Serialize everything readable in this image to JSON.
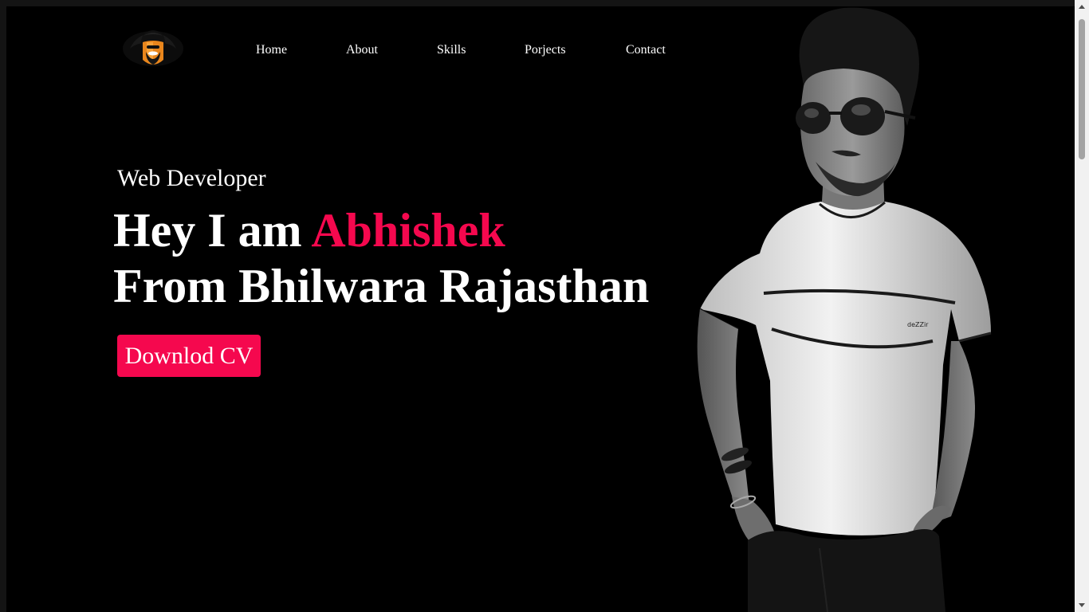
{
  "logo": {
    "icon": "bearded-man-avatar-icon"
  },
  "nav": {
    "items": [
      {
        "label": "Home"
      },
      {
        "label": "About"
      },
      {
        "label": "Skills"
      },
      {
        "label": "Porjects"
      },
      {
        "label": "Contact"
      }
    ]
  },
  "hero": {
    "subtitle": "Web Developer",
    "headline_prefix": "Hey I am ",
    "headline_name": "Abhishek",
    "headline_line2": "From Bhilwara Rajasthan",
    "cta_label": "Downlod CV",
    "shirt_brand": "deZZir"
  },
  "colors": {
    "background": "#000000",
    "accent": "#f5084e",
    "text": "#ffffff"
  }
}
